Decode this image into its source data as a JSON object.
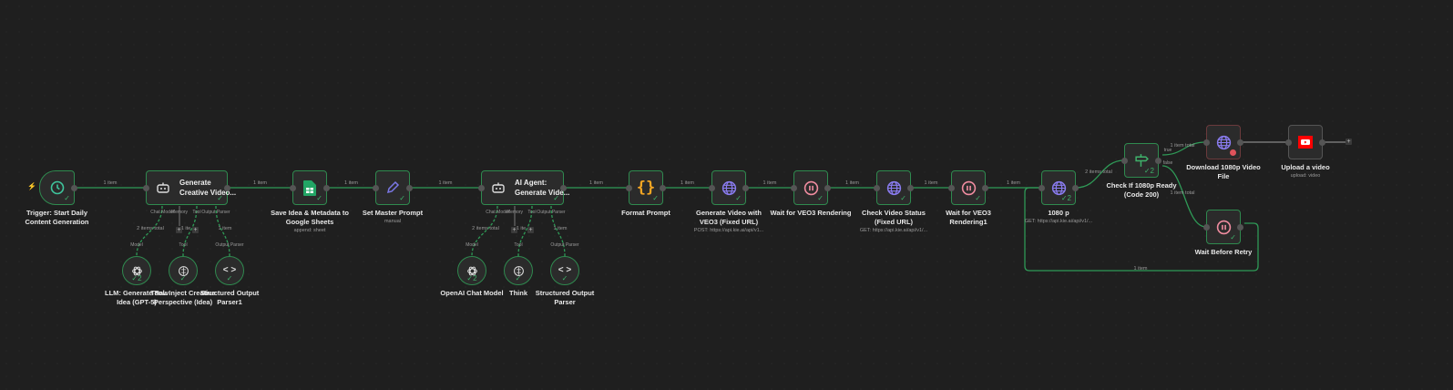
{
  "nodes": [
    {
      "id": "trigger",
      "label": "Trigger: Start Daily\nContent Generation",
      "icon": "clock-icon",
      "color": "#3fc59d",
      "status": "success"
    },
    {
      "id": "agent1",
      "label": "Generate\nCreative Video...",
      "icon": "robot-icon",
      "color": "#dddddd",
      "status": "success"
    },
    {
      "id": "sheets",
      "label": "Save Idea & Metadata to\nGoogle Sheets",
      "sub": "append: sheet",
      "icon": "google-sheets-icon",
      "color": "#22a565",
      "status": "success"
    },
    {
      "id": "setprompt",
      "label": "Set Master Prompt",
      "sub": "manual",
      "icon": "pencil-icon",
      "color": "#7b78e6",
      "status": "success"
    },
    {
      "id": "agent2",
      "label": "AI Agent:\nGenerate Vide...",
      "icon": "robot-icon",
      "color": "#dddddd",
      "status": "success"
    },
    {
      "id": "format",
      "label": "Format Prompt",
      "icon": "braces-icon",
      "color": "#f5a623",
      "status": "success"
    },
    {
      "id": "genvideo",
      "label": "Generate Video with\nVEO3 (Fixed URL)",
      "sub": "POST: https://api.kie.ai/api/v1...",
      "icon": "globe-icon",
      "color": "#8a7cf0",
      "status": "success"
    },
    {
      "id": "wait1",
      "label": "Wait for VEO3 Rendering",
      "icon": "pause-icon",
      "color": "#f08ca0",
      "status": "success"
    },
    {
      "id": "checkstatus",
      "label": "Check Video Status\n(Fixed URL)",
      "sub": "GET: https://api.kie.ai/api/v1/...",
      "icon": "globe-icon",
      "color": "#8a7cf0",
      "status": "success"
    },
    {
      "id": "wait2",
      "label": "Wait for VEO3\nRendering1",
      "icon": "pause-icon",
      "color": "#f08ca0",
      "status": "success"
    },
    {
      "id": "p1080",
      "label": "1080 p",
      "sub": "GET: https://api.kie.ai/api/v1/...",
      "icon": "globe-icon",
      "color": "#8a7cf0",
      "status": "success",
      "count": "2"
    },
    {
      "id": "ifready",
      "label": "Check If 1080p Ready\n(Code 200)",
      "icon": "signpost-icon",
      "color": "#3fb26b",
      "status": "success",
      "count": "2"
    },
    {
      "id": "download",
      "label": "Download 1080p Video\nFile",
      "icon": "globe-icon",
      "color": "#8a7cf0",
      "status": "error"
    },
    {
      "id": "upload",
      "label": "Upload a video",
      "sub": "upload: video",
      "icon": "youtube-icon",
      "color": "#ff0000",
      "status": "idle"
    },
    {
      "id": "retry",
      "label": "Wait Before Retry",
      "icon": "pause-icon",
      "color": "#f08ca0",
      "status": "success"
    },
    {
      "id": "llm1",
      "label": "LLM: Generate Raw\nIdea (GPT-5)",
      "icon": "openai-icon",
      "color": "#dddddd",
      "status": "success",
      "count": "2"
    },
    {
      "id": "tool1",
      "label": "Tool: Inject Creative\nPerspective (Idea)",
      "icon": "brain-icon",
      "color": "#dddddd",
      "status": "success"
    },
    {
      "id": "parser1",
      "label": "Structured Output\nParser1",
      "icon": "code-icon",
      "color": "#dddddd",
      "status": "success"
    },
    {
      "id": "llm2",
      "label": "OpenAI Chat Model",
      "icon": "openai-icon",
      "color": "#dddddd",
      "status": "success",
      "count": "2"
    },
    {
      "id": "tool2",
      "label": "Think",
      "icon": "brain-icon",
      "color": "#dddddd",
      "status": "success"
    },
    {
      "id": "parser2",
      "label": "Structured Output\nParser",
      "icon": "code-icon",
      "color": "#dddddd",
      "status": "success"
    }
  ],
  "port_labels": {
    "chat_model": "Chat Model",
    "memory": "Memory",
    "tool": "Tool",
    "output_parser": "Output Parser",
    "model": "Model",
    "true": "true",
    "false": "false"
  },
  "edge_labels": {
    "one": "1 item",
    "two_total": "2 items total",
    "one_total": "1 item total",
    "one_short": "1 ite"
  },
  "colors": {
    "edge": "#2f9a57",
    "edge_idle": "#888888",
    "canvas": "#1f1f1f",
    "trigger_bolt": "#e0535b"
  }
}
